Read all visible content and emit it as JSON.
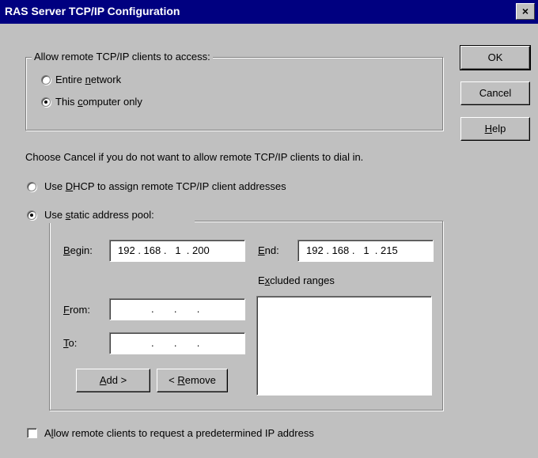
{
  "window": {
    "title": "RAS Server TCP/IP Configuration",
    "close_glyph": "×"
  },
  "access_group": {
    "legend": "Allow remote TCP/IP clients to access:",
    "option_entire_pre": "Entire ",
    "option_entire_u": "n",
    "option_entire_post": "etwork",
    "option_computer_pre": "This ",
    "option_computer_u": "c",
    "option_computer_post": "omputer only",
    "selected": "This computer only"
  },
  "buttons": {
    "ok": "OK",
    "cancel": "Cancel",
    "help_u": "H",
    "help_rest": "elp"
  },
  "info_text": "Choose Cancel if you do not want to allow remote TCP/IP clients to dial in.",
  "dhcp": {
    "pre": "Use ",
    "u": "D",
    "post": "HCP to assign remote TCP/IP client addresses",
    "checked": false
  },
  "static_pool": {
    "pre": "Use ",
    "u": "s",
    "post": "tatic address pool:",
    "checked": true,
    "begin_u": "B",
    "begin_rest": "egin:",
    "begin_ip": [
      "192",
      "168",
      "1",
      "200"
    ],
    "end_u": "E",
    "end_rest": "nd:",
    "end_ip": [
      "192",
      "168",
      "1",
      "215"
    ],
    "excluded_pre": "E",
    "excluded_u": "x",
    "excluded_post": "cluded ranges",
    "from_u": "F",
    "from_rest": "rom:",
    "to_u": "T",
    "to_rest": "o:",
    "add_u": "A",
    "add_rest": "dd >",
    "remove_pre": "< ",
    "remove_u": "R",
    "remove_rest": "emove"
  },
  "allow_predetermined": {
    "pre": "A",
    "u": "l",
    "post": "low remote clients to request a predetermined IP address",
    "checked": false
  }
}
